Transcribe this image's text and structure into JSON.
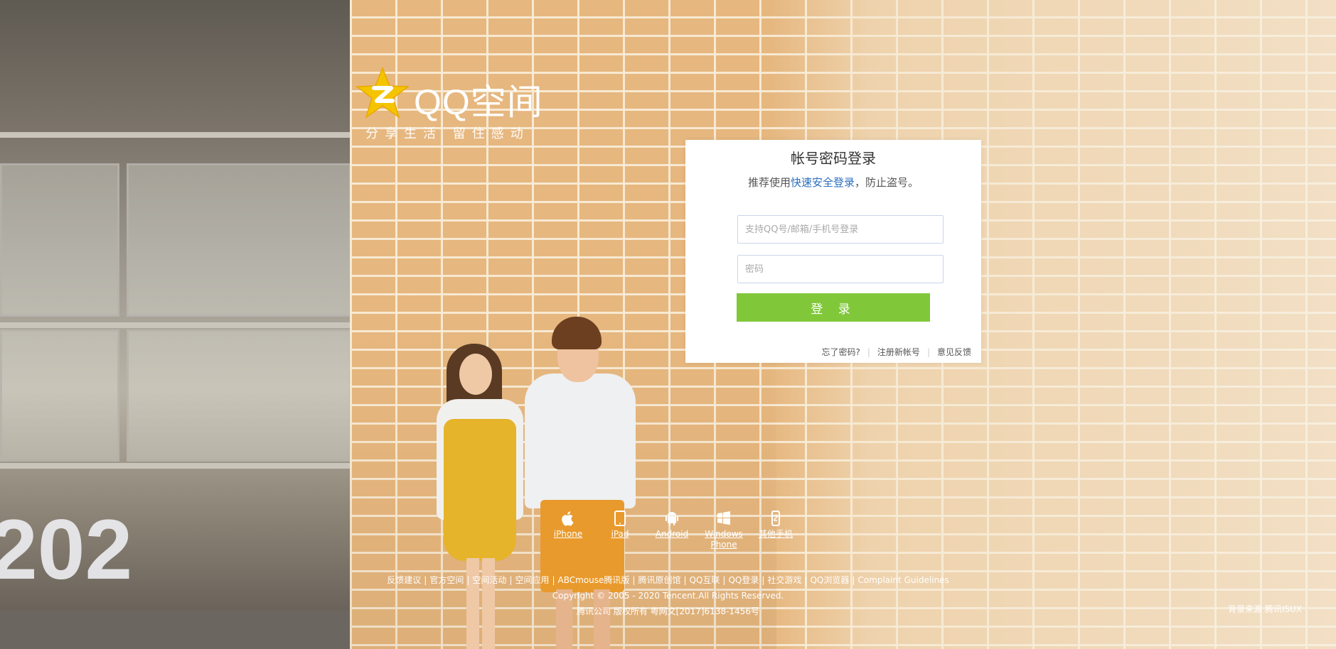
{
  "logo": {
    "text": "QQ空间",
    "slogan": "分享生活 留住感动"
  },
  "login": {
    "title": "帐号密码登录",
    "tip_prefix": "推荐使用",
    "tip_link": "快速安全登录",
    "tip_suffix": "，防止盗号。",
    "username_placeholder": "支持QQ号/邮箱/手机号登录",
    "password_placeholder": "密码",
    "submit_label": "登 录",
    "forgot_label": "忘了密码?",
    "separator": "|",
    "register_label": "注册新帐号",
    "feedback_label": "意见反馈"
  },
  "platforms": [
    {
      "label": "iPhone",
      "icon": "apple-icon"
    },
    {
      "label": "iPad",
      "icon": "tablet-icon"
    },
    {
      "label": "Android",
      "icon": "android-icon"
    },
    {
      "label": "Windows Phone",
      "icon": "windows-icon"
    },
    {
      "label": "其他手机",
      "icon": "phone-icon"
    }
  ],
  "footer": {
    "links": [
      "反馈建议",
      "官方空间",
      "空间活动",
      "空间应用",
      "ABCmouse腾讯版",
      "腾讯原创馆",
      "QQ互联",
      "QQ登录",
      "社交游戏",
      "QQ浏览器",
      "Complaint Guidelines"
    ],
    "copyright": "Copyright © 2005 - 2020 Tencent.All Rights Reserved.",
    "license": "腾讯公司 版权所有 粤网文[2017]6138-1456号",
    "bg_source_prefix": "背景来源",
    "bg_source_link": "腾讯ISUX"
  },
  "background_text": "202",
  "colors": {
    "accent_green": "#80c83a",
    "link_blue": "#2a6fbd",
    "star_yellow": "#f5c400"
  }
}
